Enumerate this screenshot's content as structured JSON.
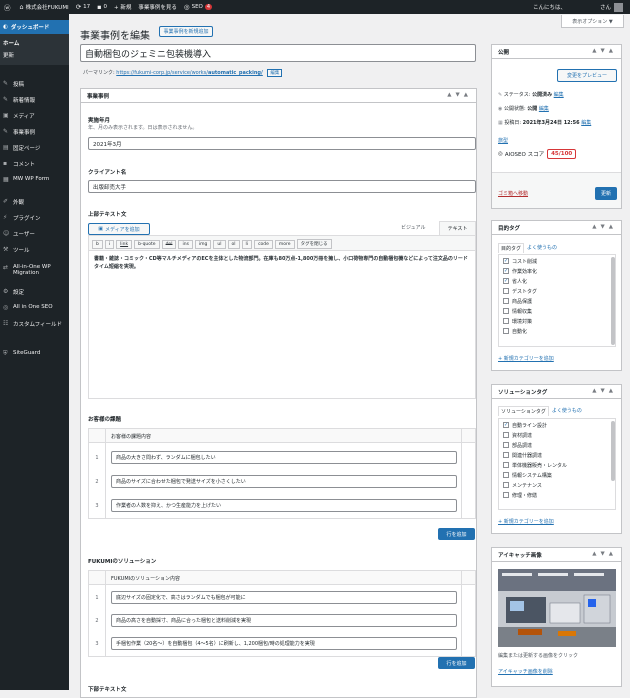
{
  "adminbar": {
    "site": "株式会社FUKUMI",
    "updates": "17",
    "comments": "0",
    "new": "+ 新規",
    "view": "事業事例を見る",
    "seo": "SEO",
    "seo_badge": "4",
    "greeting": "こんにちは、",
    "user": "さん"
  },
  "sidebar": {
    "dashboard": "ダッシュボード",
    "sub": [
      "ホーム",
      "更新"
    ],
    "items": [
      "投稿",
      "新着情報",
      "メディア",
      "事業事例",
      "固定ページ",
      "コメント",
      "MW WP Form",
      "外観",
      "プラグイン",
      "ユーザー",
      "ツール",
      "All-in-One WP Migration",
      "設定",
      "All in One SEO",
      "カスタムフィールド",
      "SiteGuard"
    ]
  },
  "header": {
    "title": "事業事例を編集",
    "new_button": "事業事例を新規追加",
    "screen_options": "表示オプション ▼"
  },
  "post": {
    "title": "自動梱包のジェミニ包装機導入",
    "permalink_label": "パーマリンク:",
    "permalink_base": "https://fukumi-corp.jp/service/works/",
    "permalink_slug": "automatic_packing/",
    "edit": "編集"
  },
  "jireimeta": {
    "title": "事業事例",
    "date_label": "実施年月",
    "date_desc": "年、月のみ表示されます。日は表示されません。",
    "date_value": "2021年3月",
    "client_label": "クライアント名",
    "client_value": "出版卸売大手",
    "upper_label": "上部テキスト文",
    "media_btn": "メディアを追加",
    "tab_visual": "ビジュアル",
    "tab_text": "テキスト",
    "quicktags": [
      "b",
      "i",
      "link",
      "b-quote",
      "del",
      "ins",
      "img",
      "ul",
      "ol",
      "li",
      "code",
      "more",
      "タグを閉じる"
    ],
    "upper_text": "書籍・雑誌・コミック・CD等マルチメディアのECを主体とした物流部門。在庫も80万点-1,800万冊を擁し、小口荷物専門の自動梱包機などによって注文品のリードタイム短縮を実現。",
    "issues_label": "お客様の課題",
    "issues_head": "お客様の課題内容",
    "issues": [
      "商品の大きさ問わず、ランダムに梱包したい",
      "商品のサイズに合わせた梱包で発送サイズを小さくしたい",
      "作業者の人数を抑え、かつ生産能力を上げたい"
    ],
    "add_row": "行を追加",
    "solution_label": "FUKUMIのソリューション",
    "solution_head": "FUKUMIのソリューション内容",
    "solutions": [
      "底辺サイズの固定化で、高さはランダムでも梱包が可能に",
      "商品の高さを自動採寸、商品に合った梱包と送料削減を実現",
      "手梱包作業（20名～）を自動梱包（4～5名）に刷新し、1,200梱包/時の処理能力を実現"
    ],
    "lower_label": "下部テキスト文"
  },
  "publish": {
    "title": "公開",
    "preview": "変更をプレビュー",
    "status_label": "ステータス:",
    "status": "公開済み",
    "visibility_label": "公開状態:",
    "visibility": "公開",
    "date_label": "投稿日:",
    "date": "2021年3月24日 12:56",
    "edit": "編集",
    "revisions": "旅型",
    "seo_label": "AIOSEO スコア",
    "seo_score": "45/100",
    "trash": "ゴミ箱へ移動",
    "update": "更新"
  },
  "tags": {
    "title": "目的タグ",
    "tab_all": "目的タグ",
    "tab_popular": "よく使うもの",
    "items": [
      {
        "label": "コスト削減",
        "checked": true
      },
      {
        "label": "作業効率化",
        "checked": true
      },
      {
        "label": "省人化",
        "checked": true
      },
      {
        "label": "デストタグ",
        "checked": false
      },
      {
        "label": "商品保護",
        "checked": false
      },
      {
        "label": "情報収集",
        "checked": false
      },
      {
        "label": "環境対策",
        "checked": false
      },
      {
        "label": "自動化",
        "checked": false
      }
    ],
    "add": "+ 新規カテゴリーを追加"
  },
  "solutiontags": {
    "title": "ソリューションタグ",
    "tab_all": "ソリューションタグ",
    "tab_popular": "よく使うもの",
    "items": [
      {
        "label": "自動ライン設計",
        "checked": true
      },
      {
        "label": "資材調達",
        "checked": false
      },
      {
        "label": "部品調達",
        "checked": false
      },
      {
        "label": "関連什器調達",
        "checked": false
      },
      {
        "label": "単体機器販売・レンタル",
        "checked": false
      },
      {
        "label": "情報システム構築",
        "checked": false
      },
      {
        "label": "メンテナンス",
        "checked": false
      },
      {
        "label": "修理・修繕",
        "checked": false
      }
    ],
    "add": "+ 新規カテゴリーを追加"
  },
  "thumbnail": {
    "title": "アイキャッチ画像",
    "hint": "編集または更新する画像をクリック",
    "remove": "アイキャッチ画像を削除"
  },
  "colors": {
    "accent": "#2271b1",
    "adminbar": "#1d2327",
    "danger": "#d63638"
  }
}
